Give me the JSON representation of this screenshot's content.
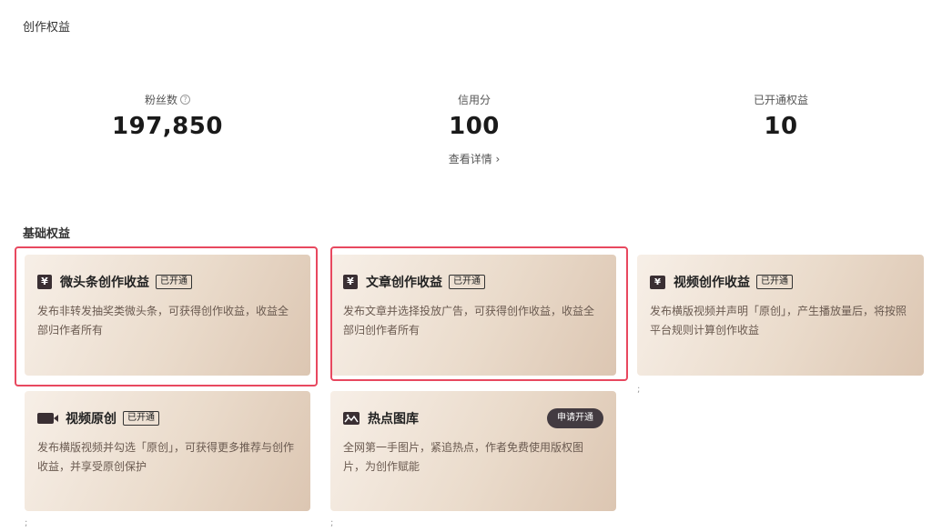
{
  "header": {
    "title": "创作权益"
  },
  "stats": {
    "fans": {
      "label": "粉丝数",
      "value": "197,850",
      "help_icon": "help-circle-icon"
    },
    "credit": {
      "label": "信用分",
      "value": "100",
      "link": "查看详情 ›"
    },
    "rights": {
      "label": "已开通权益",
      "value": "10"
    }
  },
  "basic": {
    "title": "基础权益",
    "cards": [
      {
        "icon": "yuan-icon",
        "name": "微头条创作收益",
        "badge": "已开通",
        "desc": "发布非转发抽奖类微头条，可获得创作收益，收益全部归作者所有"
      },
      {
        "icon": "yuan-icon",
        "name": "文章创作收益",
        "badge": "已开通",
        "desc": "发布文章并选择投放广告，可获得创作收益，收益全部归创作者所有"
      },
      {
        "icon": "tv-yuan-icon",
        "name": "视频创作收益",
        "badge": "已开通",
        "desc": "发布横版视频并声明「原创」，产生播放量后，将按照平台规则计算创作收益"
      },
      {
        "icon": "video-camera-icon",
        "name": "视频原创",
        "badge": "已开通",
        "desc": "发布横版视频并勾选「原创」，可获得更多推荐与创作收益，并享受原创保护"
      },
      {
        "icon": "image-icon",
        "name": "热点图库",
        "apply": "申请开通",
        "desc": "全网第一手图片，紧追热点，作者免费使用版权图片，为创作赋能"
      }
    ]
  },
  "colors": {
    "highlight": "#e8485f",
    "card_icon": "#3a2f33",
    "apply_button": "#433b41"
  }
}
